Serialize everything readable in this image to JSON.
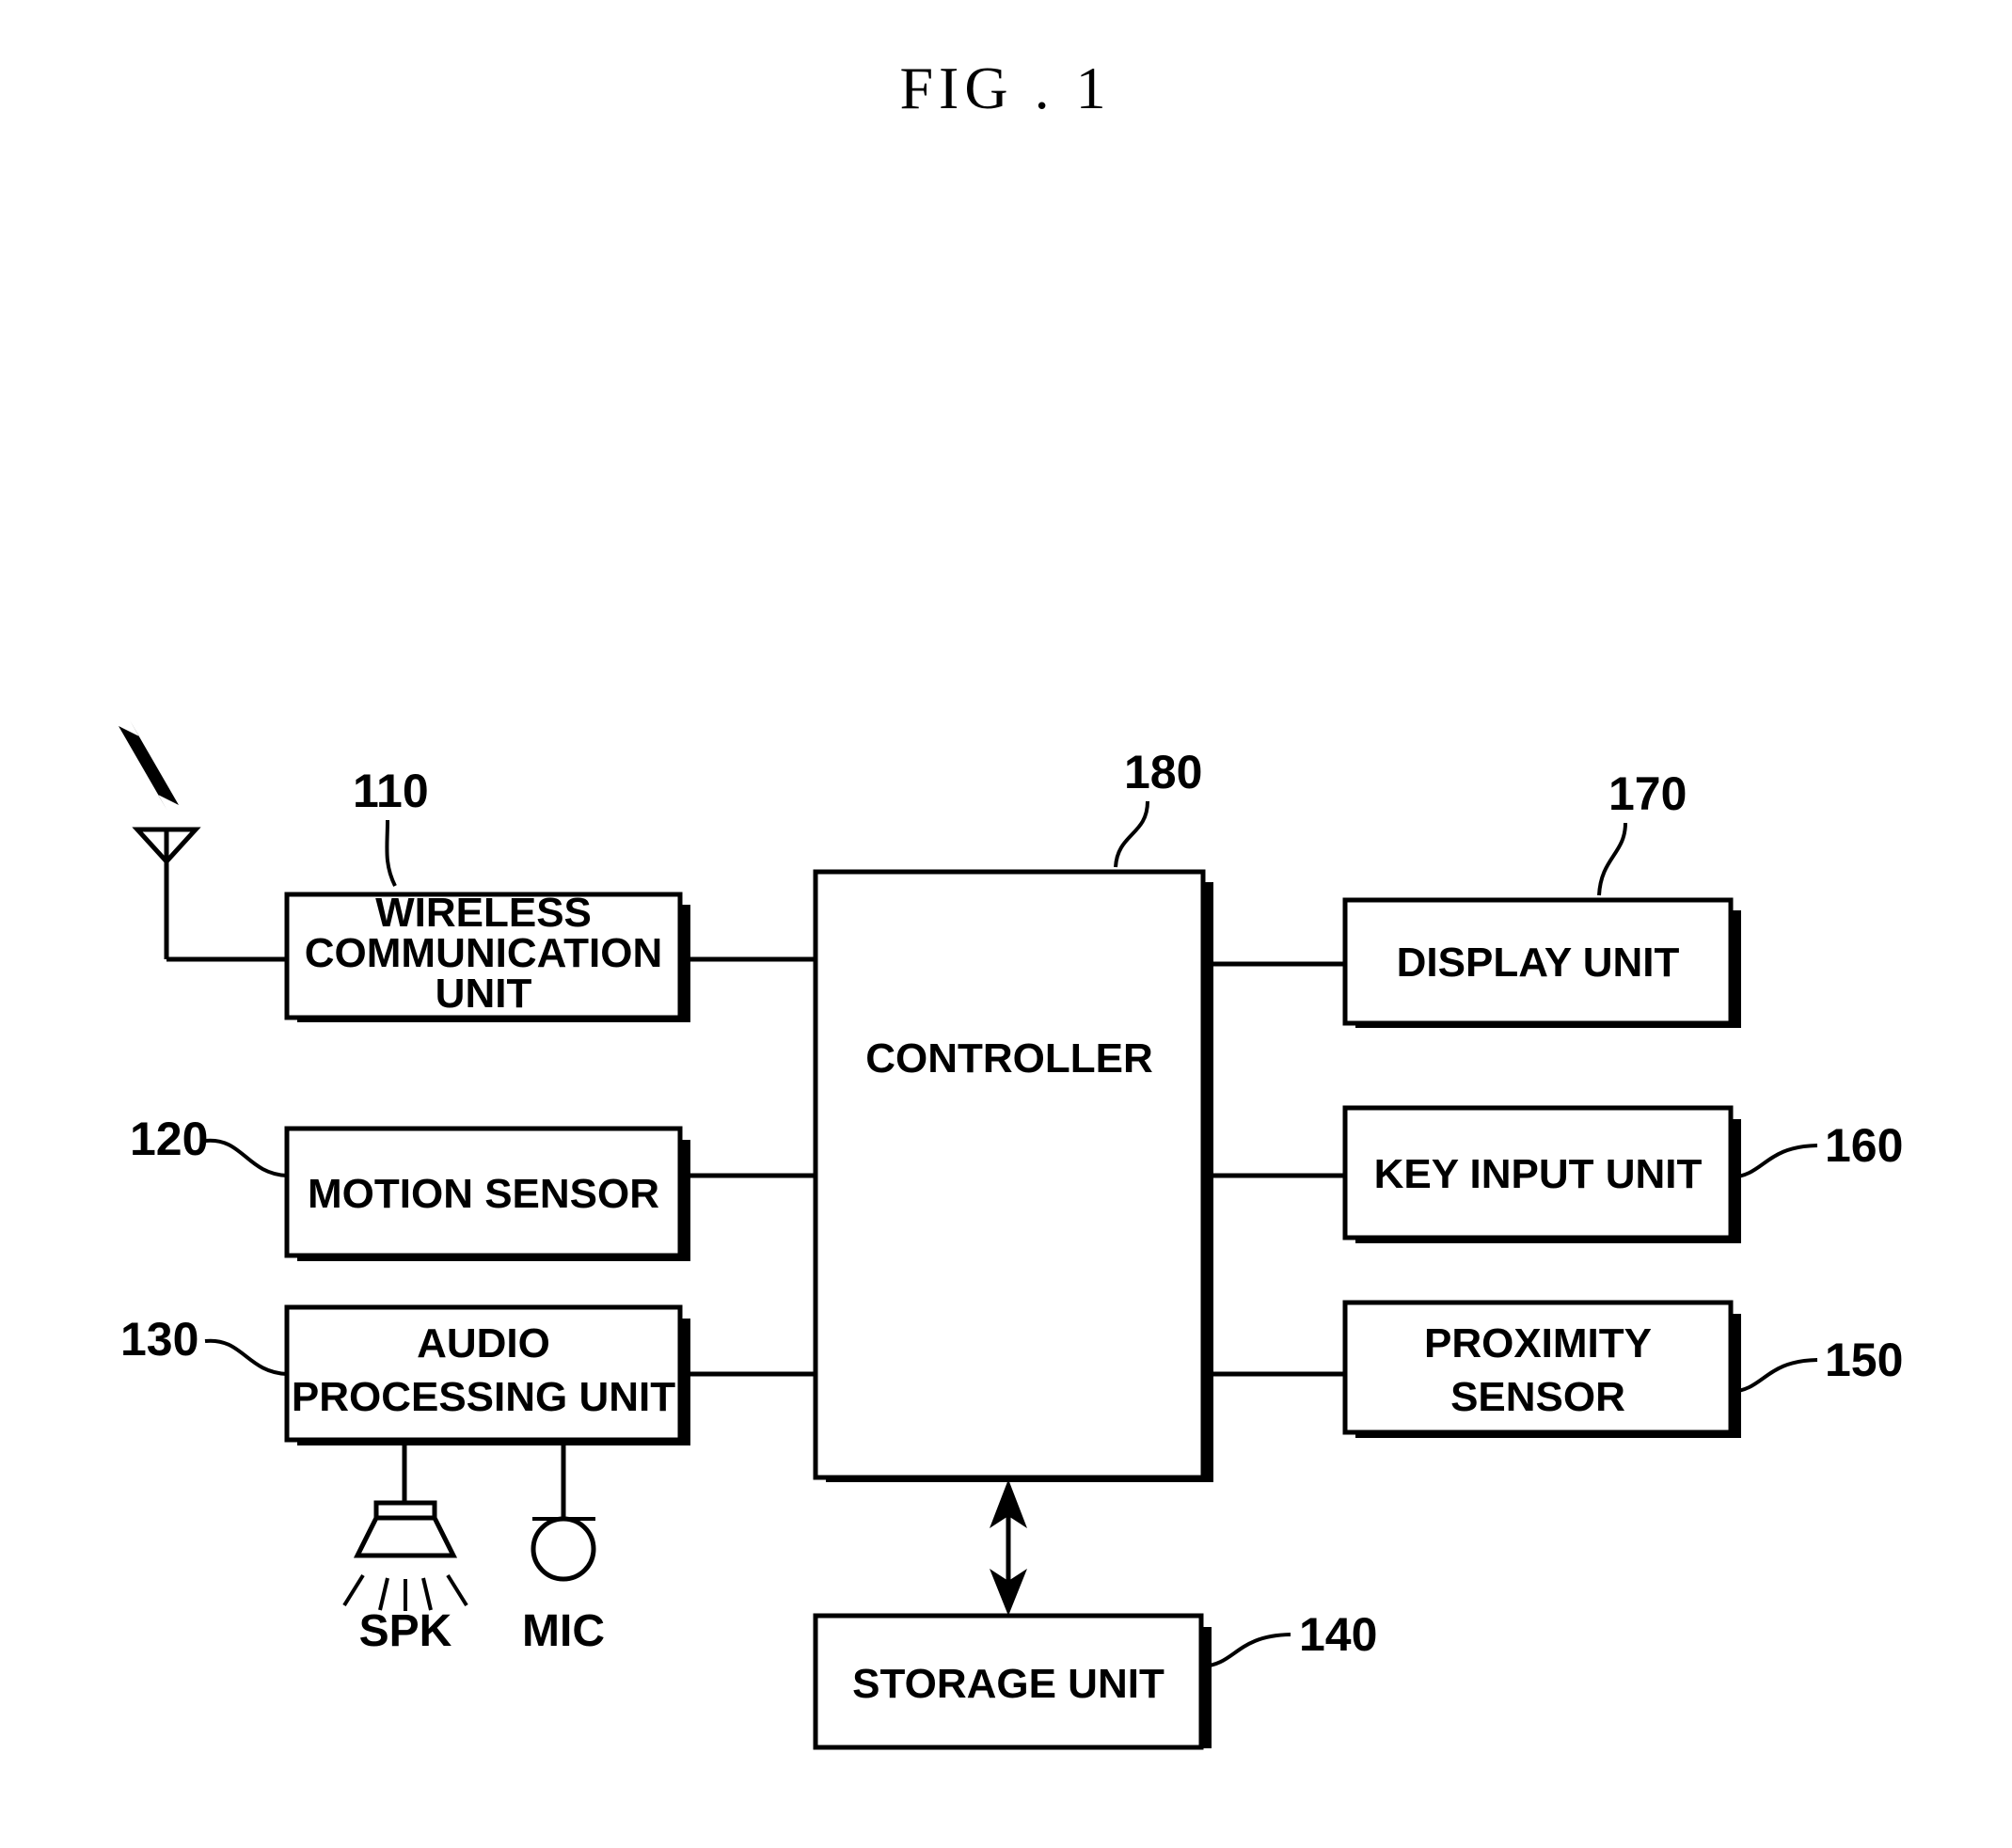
{
  "figure": {
    "title": "FIG . 1",
    "caption_text": "FIG . 1"
  },
  "blocks": [
    {
      "id": "wireless-communication-unit",
      "ref": "110",
      "lines": [
        "WIRELESS",
        "COMMUNICATION",
        "UNIT"
      ],
      "full_label": "WIRELESS COMMUNICATION UNIT"
    },
    {
      "id": "motion-sensor",
      "ref": "120",
      "lines": [
        "MOTION SENSOR"
      ],
      "full_label": "MOTION SENSOR"
    },
    {
      "id": "audio-processing-unit",
      "ref": "130",
      "lines": [
        "AUDIO",
        "PROCESSING UNIT"
      ],
      "full_label": "AUDIO PROCESSING UNIT"
    },
    {
      "id": "controller",
      "ref": "180",
      "lines": [
        "CONTROLLER"
      ],
      "full_label": "CONTROLLER"
    },
    {
      "id": "display-unit",
      "ref": "170",
      "lines": [
        "DISPLAY UNIT"
      ],
      "full_label": "DISPLAY UNIT"
    },
    {
      "id": "key-input-unit",
      "ref": "160",
      "lines": [
        "KEY INPUT UNIT"
      ],
      "full_label": "KEY INPUT UNIT"
    },
    {
      "id": "proximity-sensor",
      "ref": "150",
      "lines": [
        "PROXIMITY",
        "SENSOR"
      ],
      "full_label": "PROXIMITY SENSOR"
    },
    {
      "id": "storage-unit",
      "ref": "140",
      "lines": [
        "STORAGE UNIT"
      ],
      "full_label": "STORAGE UNIT"
    }
  ],
  "peripherals": {
    "speaker_label": "SPK",
    "mic_label": "MIC",
    "antenna_label": ""
  },
  "reference_numerals": {
    "wireless": "110",
    "motion": "120",
    "audio": "130",
    "storage": "140",
    "proximity": "150",
    "key_input": "160",
    "display": "170",
    "controller": "180"
  },
  "colors": {
    "ink": "#000000",
    "paper": "#ffffff"
  }
}
